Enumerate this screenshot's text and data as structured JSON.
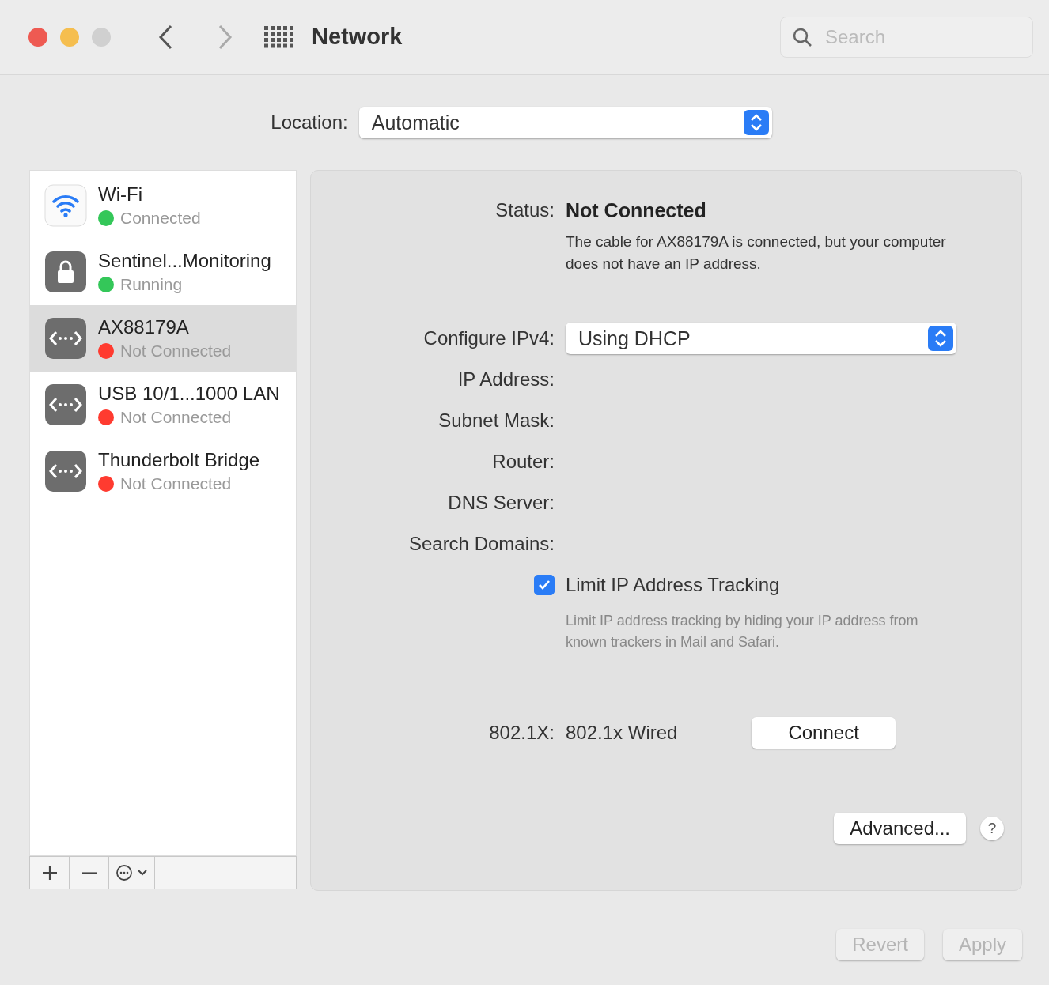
{
  "window": {
    "title": "Network"
  },
  "search": {
    "placeholder": "Search"
  },
  "location": {
    "label": "Location:",
    "value": "Automatic"
  },
  "services": [
    {
      "name": "Wi-Fi",
      "status": "Connected",
      "color": "#34c759",
      "kind": "wifi",
      "selected": false
    },
    {
      "name": "Sentinel...Monitoring",
      "status": "Running",
      "color": "#34c759",
      "kind": "vpn",
      "selected": false
    },
    {
      "name": "AX88179A",
      "status": "Not Connected",
      "color": "#ff3b30",
      "kind": "ethernet",
      "selected": true
    },
    {
      "name": "USB 10/1...1000 LAN",
      "status": "Not Connected",
      "color": "#ff3b30",
      "kind": "ethernet",
      "selected": false
    },
    {
      "name": "Thunderbolt Bridge",
      "status": "Not Connected",
      "color": "#ff3b30",
      "kind": "ethernet",
      "selected": false
    }
  ],
  "detail": {
    "status_label": "Status:",
    "status_value": "Not Connected",
    "status_description": "The cable for AX88179A is connected, but your computer does not have an IP address.",
    "configure_label": "Configure IPv4:",
    "configure_value": "Using DHCP",
    "fields": [
      "IP Address:",
      "Subnet Mask:",
      "Router:",
      "DNS Server:",
      "Search Domains:"
    ],
    "limit_tracking": {
      "label": "Limit IP Address Tracking",
      "checked": true,
      "description": "Limit IP address tracking by hiding your IP address from known trackers in Mail and Safari."
    },
    "dot1x_label": "802.1X:",
    "dot1x_value": "802.1x Wired",
    "connect": "Connect",
    "advanced": "Advanced...",
    "help": "?"
  },
  "footer": [
    {
      "label": "Revert",
      "disabled": true
    },
    {
      "label": "Apply",
      "disabled": true
    }
  ]
}
